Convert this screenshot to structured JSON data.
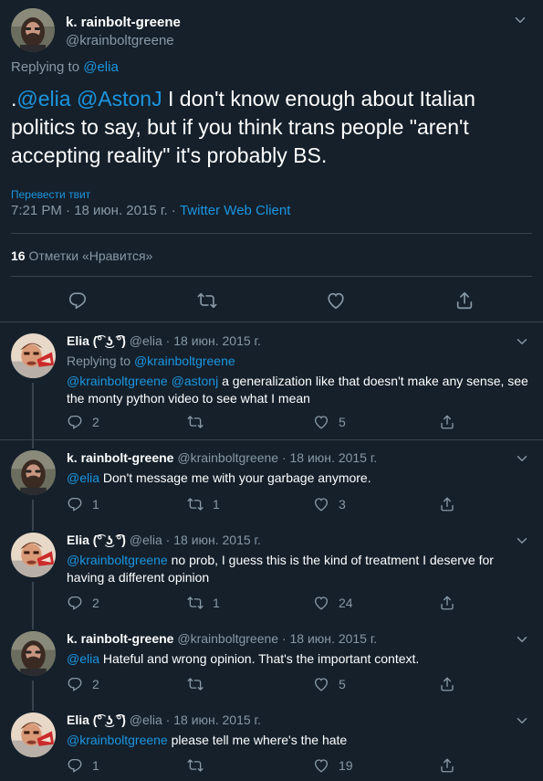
{
  "main": {
    "name": "k. rainbolt-greene",
    "handle": "@krainboltgreene",
    "replying_prefix": "Replying to ",
    "replying_to": "@elia",
    "text_dot": ".",
    "mention1": "@elia",
    "mention2": "@AstonJ",
    "text_body": " I don't know enough about Italian politics to say, but if you think trans people \"aren't accepting reality\" it's probably BS.",
    "translate": "Перевести твит",
    "timestamp": "7:21 PM · 18 июн. 2015 г. · ",
    "client": "Twitter Web Client",
    "likes_count": "16",
    "likes_label": " Отметки «Нравится»"
  },
  "replies": [
    {
      "name": "Elia (͡° ͜ʖ ͡°)",
      "handle_date": " @elia · 18 июн. 2015 г.",
      "replying_prefix": "Replying to ",
      "replying_to": "@krainboltgreene",
      "mentions": "@krainboltgreene @astonj",
      "text": " a generalization like that doesn't make any sense, see the monty python video to see what I mean",
      "replies": "2",
      "retweets": "",
      "likes": "5"
    },
    {
      "name": "k. rainbolt-greene",
      "handle_date": " @krainboltgreene · 18 июн. 2015 г.",
      "mentions": "@elia",
      "text": " Don't message me with your garbage anymore.",
      "replies": "1",
      "retweets": "1",
      "likes": "3"
    },
    {
      "name": "Elia (͡° ͜ʖ ͡°)",
      "handle_date": " @elia · 18 июн. 2015 г.",
      "mentions": "@krainboltgreene",
      "text": " no prob, I guess this is the kind of treatment I deserve for having a different opinion",
      "replies": "2",
      "retweets": "1",
      "likes": "24"
    },
    {
      "name": "k. rainbolt-greene",
      "handle_date": " @krainboltgreene · 18 июн. 2015 г.",
      "mentions": "@elia",
      "text": " Hateful and wrong opinion. That's the important context.",
      "replies": "2",
      "retweets": "",
      "likes": "5"
    },
    {
      "name": "Elia (͡° ͜ʖ ͡°)",
      "handle_date": " @elia · 18 июн. 2015 г.",
      "mentions": "@krainboltgreene",
      "text": " please tell me where's the hate",
      "replies": "1",
      "retweets": "",
      "likes": "19"
    }
  ],
  "colors": {
    "background": "#15202b",
    "link": "#1b95e0",
    "muted": "#8899a6",
    "divider": "#38444d"
  },
  "icons": [
    "chevron-down-icon",
    "reply-icon",
    "retweet-icon",
    "like-icon",
    "share-icon"
  ]
}
